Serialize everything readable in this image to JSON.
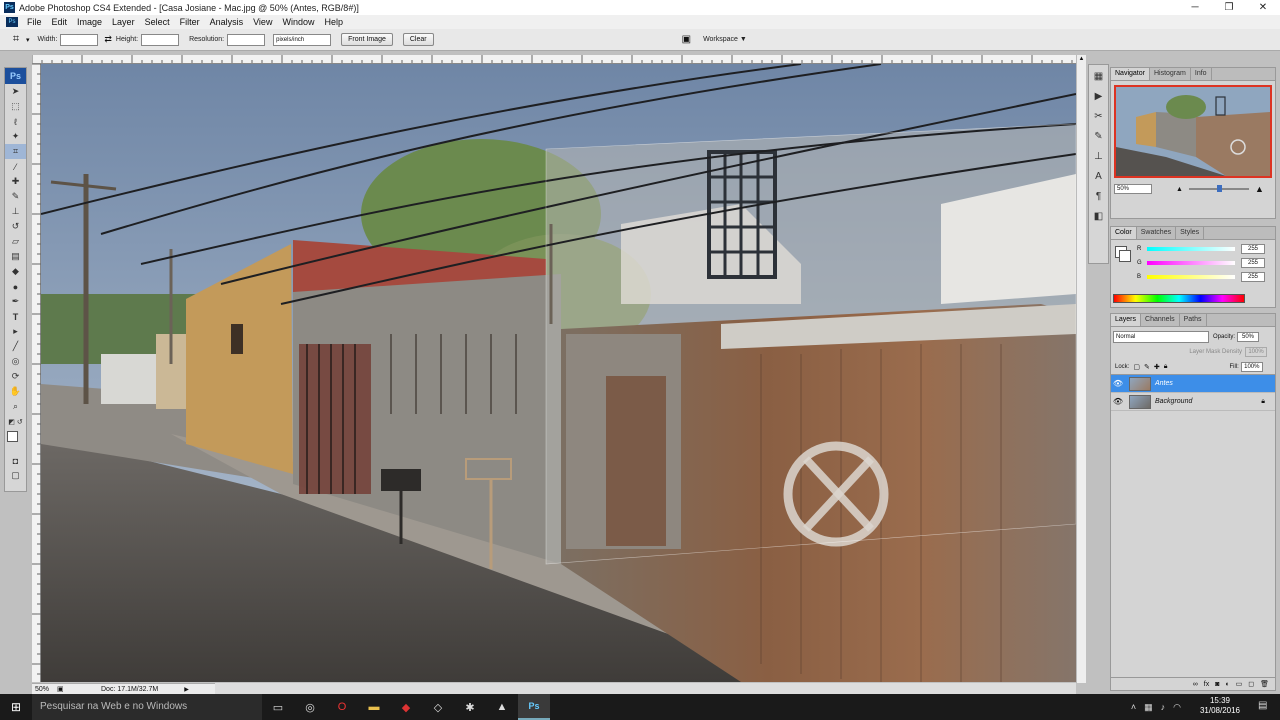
{
  "window": {
    "title": "Adobe Photoshop CS4 Extended - [Casa Josiane - Mac.jpg @ 50% (Antes, RGB/8#)]",
    "min": "─",
    "max": "❐",
    "close": "✕"
  },
  "menu": [
    "File",
    "Edit",
    "Image",
    "Layer",
    "Select",
    "Filter",
    "Analysis",
    "View",
    "Window",
    "Help"
  ],
  "options": {
    "width_label": "Width:",
    "height_label": "Height:",
    "resolution_label": "Resolution:",
    "unit": "pixels/inch",
    "front_image": "Front Image",
    "clear": "Clear",
    "workspace": "Workspace ▼"
  },
  "status": {
    "zoom": "50%",
    "doc": "Doc: 17.1M/32.7M"
  },
  "panels": {
    "navigator": {
      "tabs": [
        "Navigator",
        "Histogram",
        "Info"
      ],
      "zoom": "50%"
    },
    "color": {
      "tabs": [
        "Color",
        "Swatches",
        "Styles"
      ],
      "r_label": "R",
      "g_label": "G",
      "b_label": "B",
      "r": "255",
      "g": "255",
      "b": "255"
    },
    "layers": {
      "tabs": [
        "Layers",
        "Channels",
        "Paths"
      ],
      "blend_mode": "Normal",
      "opacity_label": "Opacity:",
      "opacity": "50%",
      "mask_density": "Layer Mask Density",
      "mask_value": "100%",
      "lock_label": "Lock:",
      "fill_label": "Fill:",
      "fill": "100%",
      "items": [
        {
          "name": "Antes"
        },
        {
          "name": "Background"
        }
      ]
    }
  },
  "taskbar": {
    "search": "Pesquisar na Web e no Windows",
    "time": "15:39",
    "date": "31/08/2016"
  },
  "colors": {
    "accent": "#3d8ee8",
    "ps_blue": "#1c4f9c"
  }
}
